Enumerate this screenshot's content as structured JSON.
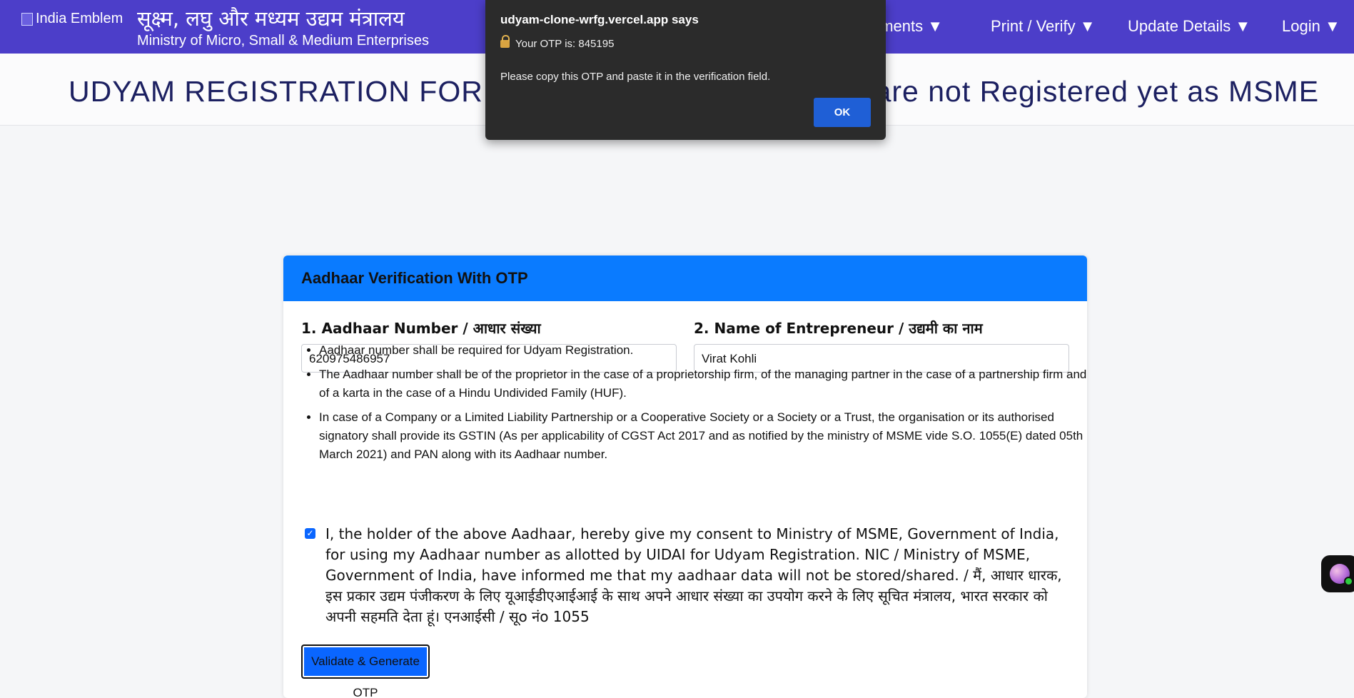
{
  "header": {
    "emblem_alt": "India Emblem",
    "ministry_hindi": "सूक्ष्म, लघु और मध्यम उद्यम मंत्रालय",
    "ministry_english": "Ministry of Micro, Small & Medium Enterprises",
    "nav": [
      {
        "label": "uments ▼"
      },
      {
        "label": "Print / Verify ▼"
      },
      {
        "label": "Update Details ▼"
      },
      {
        "label": "Login ▼"
      }
    ]
  },
  "title_band": {
    "title": "UDYAM REGISTRATION FORM - For New Enterprise who are not Registered yet as MSME"
  },
  "form": {
    "header": "Aadhaar Verification With OTP",
    "aadhaar_label": "1. Aadhaar Number / आधार संख्या",
    "aadhaar_value": "620975486957",
    "name_label": "2. Name of Entrepreneur / उद्यमी का नाम",
    "name_value": "Virat Kohli",
    "notes": [
      "Aadhaar number shall be required for Udyam Registration.",
      "The Aadhaar number shall be of the proprietor in the case of a proprietorship firm, of the managing partner in the case of a partnership firm and of a karta in the case of a Hindu Undivided Family (HUF).",
      "In case of a Company or a Limited Liability Partnership or a Cooperative Society or a Society or a Trust, the organisation or its authorised signatory shall provide its GSTIN (As per applicability of CGST Act 2017 and as notified by the ministry of MSME vide S.O. 1055(E) dated 05th March 2021) and PAN along with its Aadhaar number."
    ],
    "consent_checked": true,
    "consent_text": "I, the holder of the above Aadhaar, hereby give my consent to Ministry of MSME, Government of India, for using my Aadhaar number as allotted by UIDAI for Udyam Registration. NIC / Ministry of MSME, Government of India, have informed me that my aadhaar data will not be stored/shared. / मैं, आधार धारक, इस प्रकार उद्यम पंजीकरण के लिए यूआईडीएआईआई के साथ अपने आधार संख्या का उपयोग करने के लिए सूचित मंत्रालय, भारत सरकार को अपनी सहमति देता हूं। एनआईसी / सूo नंo 1055",
    "validate_button": "Validate & Generate OTP"
  },
  "dialog": {
    "title": "udyam-clone-wrfg.vercel.app says",
    "otp_line": "Your OTP is: 845195",
    "message": "Please copy this OTP and paste it in the verification field.",
    "ok_label": "OK"
  },
  "colors": {
    "header_bg": "#4c3ec9",
    "card_header_bg": "#0a7bff",
    "button_bg": "#0a66ff",
    "dialog_bg": "#2b2b2b",
    "dialog_ok_bg": "#1f5fd6",
    "title_color": "#1c2061"
  }
}
